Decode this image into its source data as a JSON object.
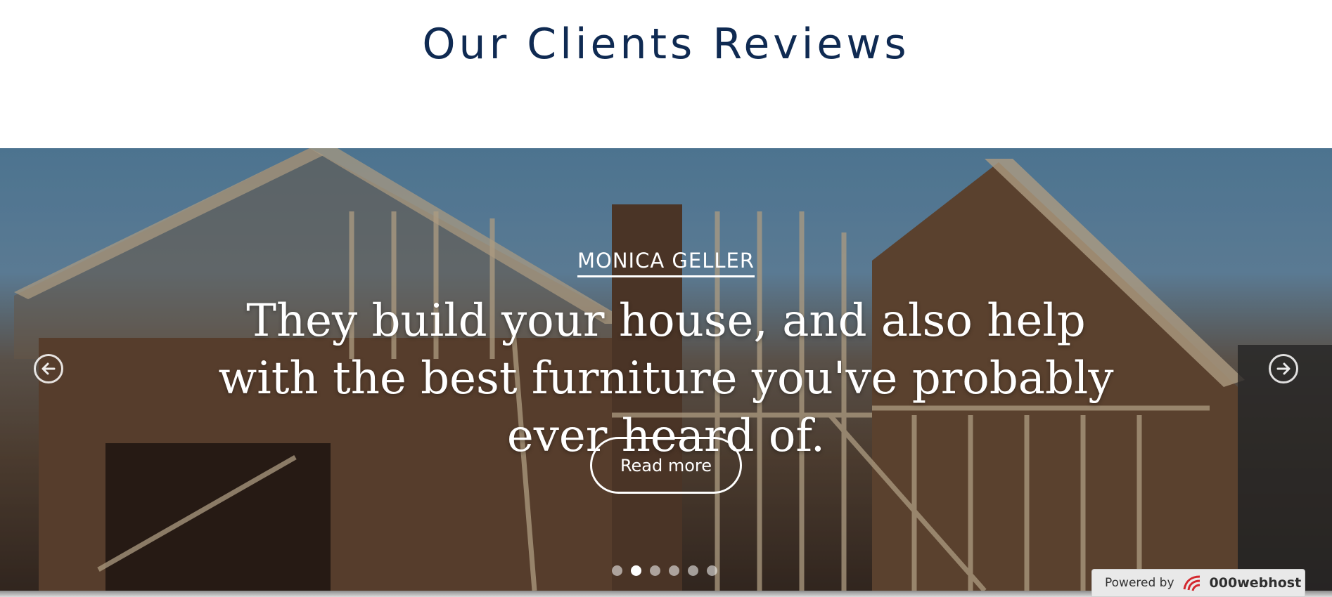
{
  "section": {
    "title": "Our Clients Reviews"
  },
  "slide": {
    "client_name": "MONICA GELLER",
    "quote": "They build your house, and also help with the best furniture you've probably ever heard of.",
    "button_label": "Read more"
  },
  "carousel": {
    "dot_count": 6,
    "active_index": 1,
    "prev_icon": "arrow-left-circle-icon",
    "next_icon": "arrow-right-circle-icon"
  },
  "footer_badge": {
    "label": "Powered by",
    "brand": "000webhost",
    "logo_icon": "000webhost-logo-icon"
  },
  "colors": {
    "title": "#0f2a52",
    "slide_text": "#ffffff",
    "badge_bg": "#e9e9e9"
  }
}
